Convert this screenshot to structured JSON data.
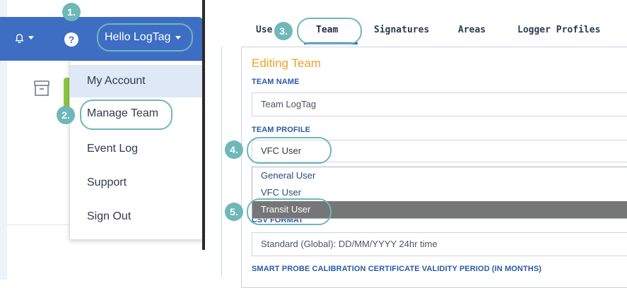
{
  "header": {
    "greeting": "Hello LogTag",
    "help_glyph": "?",
    "icons": {
      "bell": "bell-icon",
      "help": "help-icon"
    },
    "colors": {
      "topbar": "#3e6ec4",
      "accent": "#6fb7b8",
      "title": "#f0a12b"
    }
  },
  "account_menu": {
    "items": [
      {
        "label": "My Account"
      },
      {
        "label": "Manage Team"
      },
      {
        "label": "Event Log"
      },
      {
        "label": "Support"
      },
      {
        "label": "Sign Out"
      }
    ]
  },
  "tabs": [
    {
      "label": "Use"
    },
    {
      "label": "Team"
    },
    {
      "label": "Signatures"
    },
    {
      "label": "Areas"
    },
    {
      "label": "Logger Profiles"
    }
  ],
  "form": {
    "title": "Editing Team",
    "team_name_label": "TEAM NAME",
    "team_name_value": "Team LogTag",
    "team_profile_label": "TEAM PROFILE",
    "team_profile_value": "VFC User",
    "profile_options": [
      {
        "label": "General User"
      },
      {
        "label": "VFC User"
      },
      {
        "label": "Transit User"
      }
    ],
    "csv_format_label": "CSV FORMAT",
    "csv_format_value": "Standard (Global): DD/MM/YYYY 24hr time",
    "calibration_label": "SMART PROBE CALIBRATION CERTIFICATE VALIDITY PERIOD (IN MONTHS)"
  },
  "callouts": [
    "1.",
    "2.",
    "3.",
    "4.",
    "5."
  ]
}
